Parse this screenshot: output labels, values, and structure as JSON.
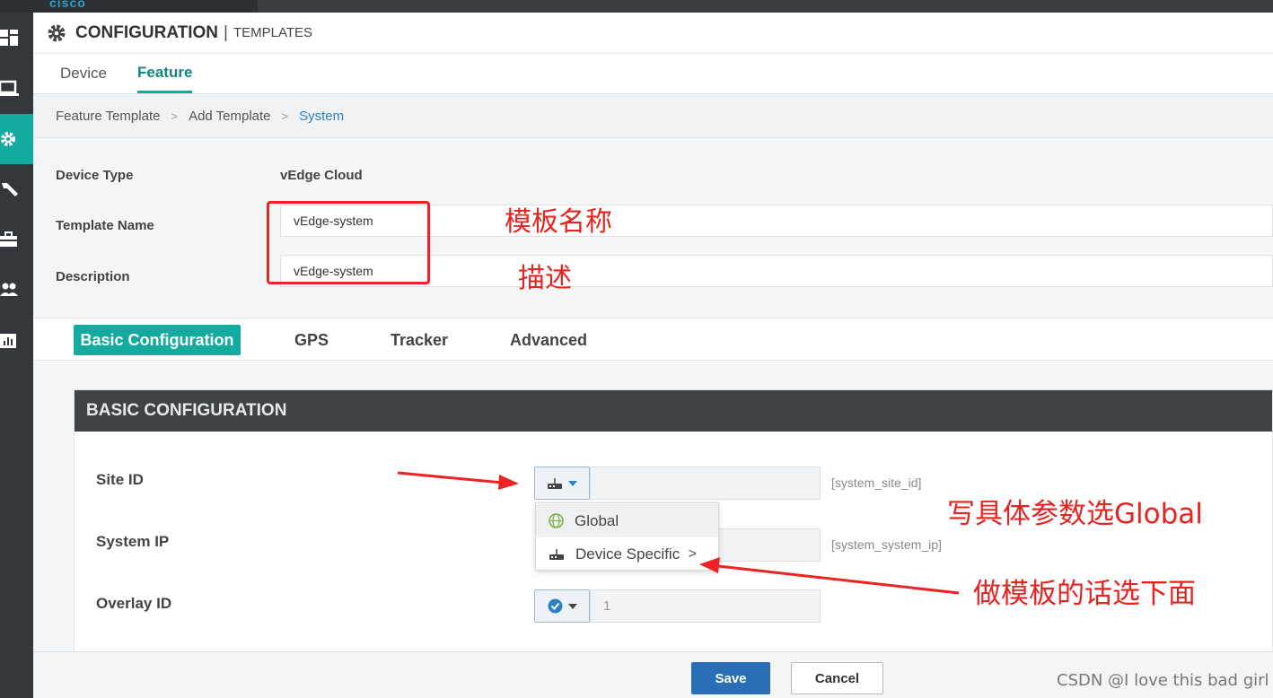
{
  "app": {
    "logo": "cisco"
  },
  "sidebar": {
    "items": [
      {
        "icon": "dashboard-icon"
      },
      {
        "icon": "monitor-icon"
      },
      {
        "icon": "gear-icon",
        "active": true
      },
      {
        "icon": "wrench-icon"
      },
      {
        "icon": "briefcase-icon"
      },
      {
        "icon": "users-icon"
      },
      {
        "icon": "chart-icon"
      }
    ]
  },
  "header": {
    "title": "CONFIGURATION",
    "separator": "|",
    "subtitle": "TEMPLATES"
  },
  "tabs": [
    {
      "label": "Device"
    },
    {
      "label": "Feature",
      "active": true
    }
  ],
  "breadcrumb": {
    "items": [
      "Feature Template",
      "Add Template"
    ],
    "current": "System",
    "separator": ">"
  },
  "info": {
    "device_type_label": "Device Type",
    "device_type_value": "vEdge Cloud",
    "template_name_label": "Template Name",
    "template_name_value": "vEdge-system",
    "description_label": "Description",
    "description_value": "vEdge-system"
  },
  "annotations": {
    "template_name_note": "模板名称",
    "description_note": "描述",
    "global_note": "写具体参数选Global",
    "device_specific_note": "做模板的话选下面"
  },
  "subtabs": [
    {
      "label": "Basic Configuration",
      "active": true
    },
    {
      "label": "GPS"
    },
    {
      "label": "Tracker"
    },
    {
      "label": "Advanced"
    }
  ],
  "basic": {
    "heading": "BASIC CONFIGURATION",
    "fields": [
      {
        "label": "Site ID",
        "hint": "[system_site_id]",
        "value": ""
      },
      {
        "label": "System IP",
        "hint": "[system_system_ip]",
        "value": ""
      },
      {
        "label": "Overlay ID",
        "value": "1"
      }
    ]
  },
  "dropdown_menu": {
    "items": [
      {
        "label": "Global",
        "icon": "globe-icon"
      },
      {
        "label": "Device Specific",
        "icon": "router-icon",
        "chevron": ">"
      }
    ]
  },
  "footer": {
    "save_label": "Save",
    "cancel_label": "Cancel"
  },
  "watermark": "CSDN @I love this bad girl",
  "colors": {
    "accent": "#13aaa0",
    "link": "#2a82c4",
    "annotation": "#e8231f",
    "save": "#2a6fb5"
  }
}
